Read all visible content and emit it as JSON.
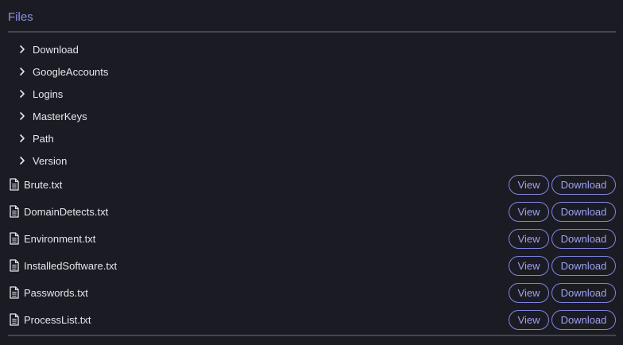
{
  "section": {
    "title": "Files"
  },
  "folders": [
    {
      "label": "Download",
      "icon": "chevron-right-icon"
    },
    {
      "label": "GoogleAccounts",
      "icon": "chevron-right-icon"
    },
    {
      "label": "Logins",
      "icon": "chevron-right-icon"
    },
    {
      "label": "MasterKeys",
      "icon": "chevron-right-icon"
    },
    {
      "label": "Path",
      "icon": "chevron-right-icon"
    },
    {
      "label": "Version",
      "icon": "chevron-right-icon"
    }
  ],
  "files": [
    {
      "name": "Brute.txt",
      "icon": "file-text-icon",
      "view_label": "View",
      "download_label": "Download"
    },
    {
      "name": "DomainDetects.txt",
      "icon": "file-text-icon",
      "view_label": "View",
      "download_label": "Download"
    },
    {
      "name": "Environment.txt",
      "icon": "file-text-icon",
      "view_label": "View",
      "download_label": "Download"
    },
    {
      "name": "InstalledSoftware.txt",
      "icon": "file-text-icon",
      "view_label": "View",
      "download_label": "Download"
    },
    {
      "name": "Passwords.txt",
      "icon": "file-text-icon",
      "view_label": "View",
      "download_label": "Download"
    },
    {
      "name": "ProcessList.txt",
      "icon": "file-text-icon",
      "view_label": "View",
      "download_label": "Download"
    }
  ],
  "colors": {
    "background": "#1b1c23",
    "accent": "#8c8fe6",
    "text": "#e6e7ee",
    "divider": "#45464f"
  }
}
